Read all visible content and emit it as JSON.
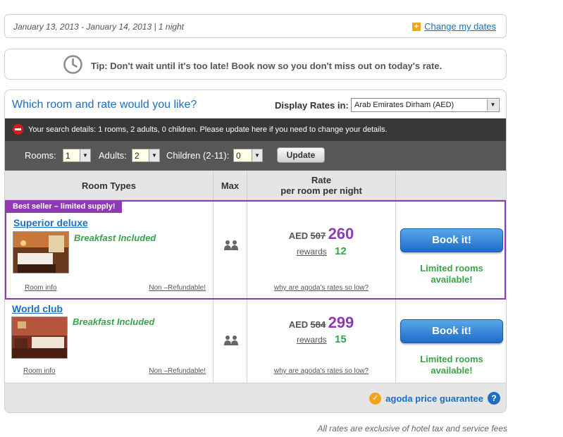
{
  "dates": {
    "text": "January 13, 2013 - January 14, 2013 | 1 night",
    "change_label": "Change my dates"
  },
  "tip": {
    "text": "Tip: Don't wait until it's too late! Book now so you don't miss out on today's rate."
  },
  "panel": {
    "title": "Which room and rate would you like?",
    "display_rates_label": "Display Rates in:",
    "currency_selected": "Arab Emirates Dirham (AED)"
  },
  "search_details": {
    "text": "Your search details: 1 rooms, 2 adults, 0 children. Please update here if you need to change your details."
  },
  "controls": {
    "rooms_label": "Rooms:",
    "rooms_value": "1",
    "adults_label": "Adults:",
    "adults_value": "2",
    "children_label": "Children (2-11):",
    "children_value": "0",
    "update_label": "Update"
  },
  "table": {
    "headers": {
      "room_types": "Room Types",
      "max": "Max",
      "rate_line1": "Rate",
      "rate_line2": "per room per night"
    },
    "rows": [
      {
        "badge": "Best seller – limited supply!",
        "name": "Superior deluxe",
        "breakfast": "Breakfast Included",
        "room_info": "Room info",
        "refund": "Non –Refundable!",
        "currency": "AED",
        "old_price": "507",
        "price": "260",
        "rewards_label": "rewards",
        "rewards_value": "12",
        "why_label": "why are agoda's rates so low?",
        "book_label": "Book it!",
        "availability_line1": "Limited rooms",
        "availability_line2": "available!"
      },
      {
        "name": "World club",
        "breakfast": "Breakfast Included",
        "room_info": "Room info",
        "refund": "Non –Refundable!",
        "currency": "AED",
        "old_price": "584",
        "price": "299",
        "rewards_label": "rewards",
        "rewards_value": "15",
        "why_label": "why are agoda's rates so low?",
        "book_label": "Book it!",
        "availability_line1": "Limited rooms",
        "availability_line2": "available!"
      }
    ]
  },
  "footer": {
    "guarantee": "agoda price guarantee",
    "help_symbol": "?",
    "disclaimer": "All rates are exclusive of hotel tax and service fees"
  },
  "colors": {
    "accent_blue": "#1a6fc4",
    "purple": "#8e3ab5",
    "green": "#3aa24a",
    "orange": "#f1a51d"
  }
}
